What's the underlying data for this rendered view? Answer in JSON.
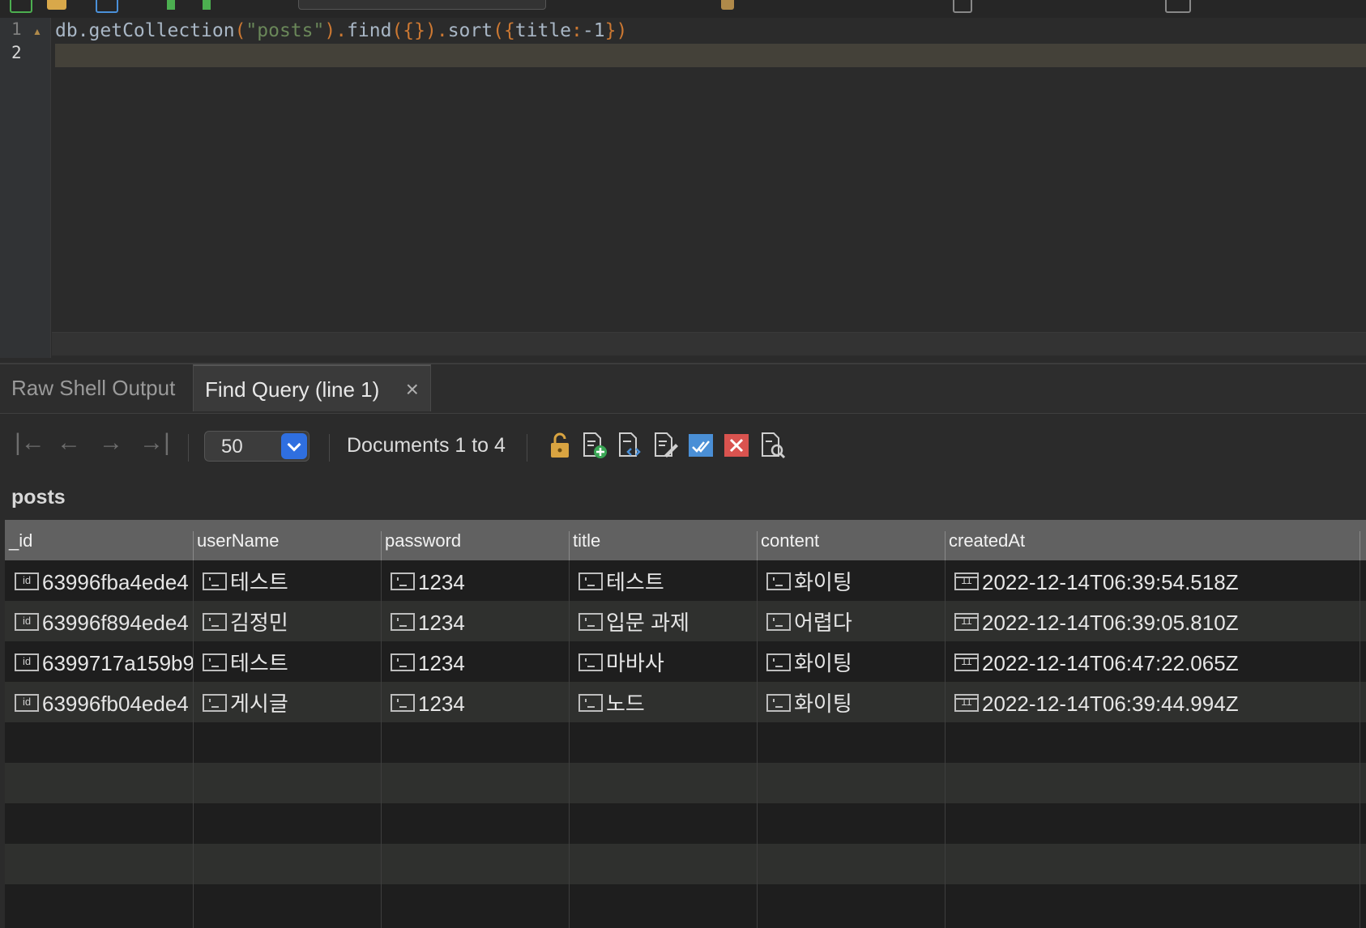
{
  "editor": {
    "line_numbers": [
      "1",
      "2"
    ],
    "code_tokens": [
      {
        "t": "db.getCollection",
        "c": "plain"
      },
      {
        "t": "(",
        "c": "punc"
      },
      {
        "t": "\"posts\"",
        "c": "str"
      },
      {
        "t": ").",
        "c": "punc"
      },
      {
        "t": "find",
        "c": "plain"
      },
      {
        "t": "({}).",
        "c": "punc"
      },
      {
        "t": "sort",
        "c": "plain"
      },
      {
        "t": "({",
        "c": "punc"
      },
      {
        "t": "title",
        "c": "plain"
      },
      {
        "t": ":",
        "c": "punc"
      },
      {
        "t": "-1",
        "c": "plain"
      },
      {
        "t": "})",
        "c": "punc"
      }
    ]
  },
  "tabs": {
    "raw": "Raw Shell Output",
    "find": "Find Query (line 1)",
    "close": "×"
  },
  "pager": {
    "first": "|←",
    "prev": "←",
    "next": "→",
    "last": "→|",
    "page_size": "50",
    "documents": "Documents 1 to 4"
  },
  "collection": "posts",
  "table": {
    "columns": [
      "_id",
      "userName",
      "password",
      "title",
      "content",
      "createdAt"
    ],
    "rows": [
      [
        "63996fba4ede4",
        "테스트",
        "1234",
        "테스트",
        "화이팅",
        "2022-12-14T06:39:54.518Z"
      ],
      [
        "63996f894ede4",
        "김정민",
        "1234",
        "입문 과제",
        "어렵다",
        "2022-12-14T06:39:05.810Z"
      ],
      [
        "6399717a159b9",
        "테스트",
        "1234",
        "마바사",
        "화이팅",
        "2022-12-14T06:47:22.065Z"
      ],
      [
        "63996fb04ede4",
        "게시글",
        "1234",
        "노드",
        "화이팅",
        "2022-12-14T06:39:44.994Z"
      ]
    ],
    "empty_rows": 5,
    "cell_icons": [
      "id-icon",
      "string-icon",
      "string-icon",
      "string-icon",
      "string-icon",
      "date-icon"
    ]
  },
  "colors": {
    "accent": "#2f6fe0",
    "string": "#6a8759",
    "keyword": "#cc7832"
  }
}
